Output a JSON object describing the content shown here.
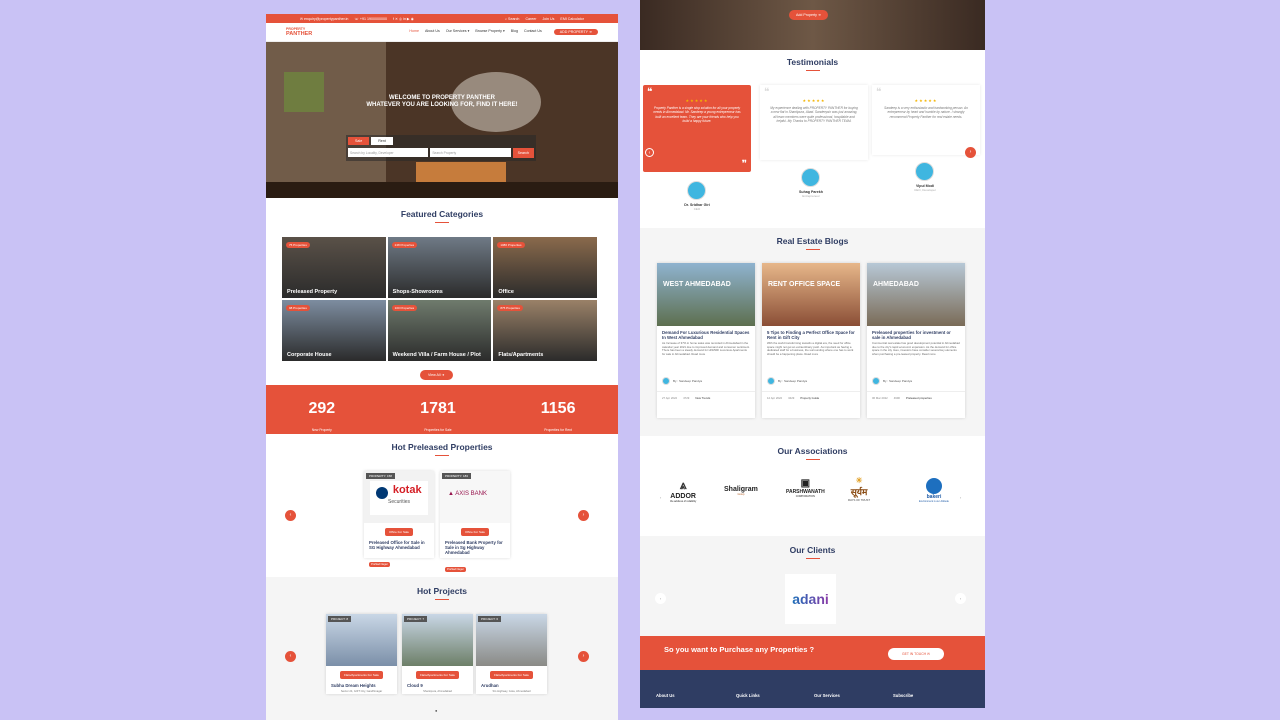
{
  "left": {
    "topbar": {
      "email": "✉ enquiry@propertypanther.in",
      "phone": "☏ +91 1900000000",
      "search": "⌕ Search",
      "links": [
        "Career",
        "Join Us",
        "EMI Calculator"
      ]
    },
    "logo": {
      "line1": "PROPERTY",
      "line2": "PANTHER"
    },
    "nav": [
      "Home",
      "About Us",
      "Our Services ▾",
      "Browse Property ▾",
      "Blog",
      "Contact Us"
    ],
    "nav_cta": "ADD PROPERTY ➜",
    "hero": {
      "line1": "WELCOME TO PROPERTY PANTHER",
      "line2": "WHATEVER YOU ARE LOOKING FOR, FIND IT HERE!"
    },
    "search": {
      "tab_sale": "Sale",
      "tab_rent": "Rent",
      "placeholder_locality": "Search by Locality, Developer",
      "placeholder_property": "Search Property",
      "button": "Search"
    },
    "featured": {
      "title": "Featured Categories",
      "items": [
        {
          "badge": "75 Properties",
          "name": "Preleased Property",
          "color": "#5a5148"
        },
        {
          "badge": "248 Properties",
          "name": "Shops-Showrooms",
          "color": "#6f7a86"
        },
        {
          "badge": "1086 Properties",
          "name": "Office",
          "color": "#8a6a4c"
        },
        {
          "badge": "98 Properties",
          "name": "Corporate House",
          "color": "#7d8da0"
        },
        {
          "badge": "100 Properties",
          "name": "Weekend Villa / Farm House / Plot",
          "color": "#6f7b6d"
        },
        {
          "badge": "875 Properties",
          "name": "Flats/Apartments",
          "color": "#9a8168"
        }
      ],
      "view_all": "View All ➜"
    },
    "stats": [
      {
        "num": "292",
        "label": "New Property"
      },
      {
        "num": "1781",
        "label": "Properties for Sale"
      },
      {
        "num": "1156",
        "label": "Properties for Rent"
      }
    ],
    "preleased": {
      "title": "Hot Preleased Properties",
      "cards": [
        {
          "tag": "PROPERTY: 158",
          "logo": "kotak",
          "logo_sub": "Securities",
          "pill": "Office For Sale",
          "title": "Preleased Office for Sale in SG Highway Ahmedabad",
          "loc": "Prahlad Nagar"
        },
        {
          "tag": "PROPERTY: 183",
          "logo": "AXIS BANK",
          "logo_sub": "",
          "pill": "Office For Sale",
          "title": "Preleased Bank Property for Sale in Sg Highway Ahmedabad",
          "loc": "Prahlad Nagar"
        }
      ]
    },
    "projects": {
      "title": "Hot Projects",
      "cards": [
        {
          "tag": "PROJECT: 8",
          "pill": "Flats/Apartments For Sale",
          "title": "Subha Dream Heights",
          "loc": "Sector 24, GIFT City, Gandhinagar",
          "color": "#7b8fa8"
        },
        {
          "tag": "PROJECT: 7",
          "pill": "Flats/Apartments For Sale",
          "title": "Cloud 9",
          "loc": "Shantipura, Ahmedabad",
          "color": "#6d7f68"
        },
        {
          "tag": "PROJECT: 6",
          "pill": "Flats/Apartments For Sale",
          "title": "Arudhan",
          "loc": "SG Highway, Gota, Ahmedabad",
          "color": "#8a8a86"
        }
      ]
    }
  },
  "right": {
    "add_property": "Add Property ➜",
    "testimonials": {
      "title": "Testimonials",
      "items": [
        {
          "text": "Property Panther is a single stop solution for all your property needs in Ahmedabad. Mr. Sandeep a young entrepreneur has built an excellent team. They are your friends who help you build a happy future.",
          "name": "Dr. Sridhar Giri",
          "role": "CEO"
        },
        {
          "text": "My experience dealing with PROPERTY PANTHER for buying a new flat in Shantipura, Abad. Sandeepsir was just amazing, all team members were quite professional, hospitable and helpful. My Thanks to PROPERTY PANTHER TEAM.",
          "name": "Suhag Parekh",
          "role": "Entrepreneur"
        },
        {
          "text": "Sandeep is a very enthusiastic and hardworking person. An entrepreneur by heart and humble by nature. I strongly recommend Property Panther for real estate needs.",
          "name": "Vipul Modi",
          "role": "CEO, Developer"
        }
      ],
      "stars": "★★★★★"
    },
    "blogs": {
      "title": "Real Estate Blogs",
      "items": [
        {
          "img_text": "WEST AHMEDABAD",
          "title": "Demand For Luxurious Residential Spaces In West Ahmedabad",
          "excerpt": "As Increase of 37% in home sales was recorded in Ahmedabad in the calendar year 2021 due to improved demand and consumer sentiment. There has been a steady demand for HNI/NRI Luxurious Apartments for sale in Ahmedabad. Read more",
          "author": "By : Sandeep Pandya",
          "date": "27 Apr 2022",
          "views": "4729",
          "cat": "New Trends"
        },
        {
          "img_text": "RENT OFFICE SPACE",
          "title": "5 Tips to Finding a Perfect Office Space for Rent in Gift City",
          "excerpt": "With the world transforming towards a digital era, the need for office space might not get an extraordinary push. As important as having a dedicated staff for a business, the surrounding where one has to work should be a happening place. Read more",
          "author": "By : Sandeep Pandya",
          "date": "12 Apr 2022",
          "views": "3429",
          "cat": "Property Guide"
        },
        {
          "img_text": "AHMEDABAD",
          "title": "Preleased properties for investment or sale in Ahmedabad",
          "excerpt": "Commercial real estate has good development potential in Ahmedabad due to the city's rapid economic expansion. As the demand for office space in the city rises, investors have consider several key elements when purchasing a pre-leased property. Read more",
          "author": "By : Sandeep Pandya",
          "date": "06 Mar 2022",
          "views": "4990",
          "cat": "Preleased properties"
        }
      ]
    },
    "associations": {
      "title": "Our Associations",
      "items": [
        {
          "name": "ADDOR",
          "sub": "the address of reliability"
        },
        {
          "name": "Shaligram",
          "sub": "Group"
        },
        {
          "name": "PARSHWANATH",
          "sub": "CORPORATION"
        },
        {
          "name": "सूर्यम",
          "sub": "RAYS OF TRUST"
        },
        {
          "name": "bakeri",
          "sub": "Environment is our Attitude"
        }
      ]
    },
    "clients": {
      "title": "Our Clients",
      "logo": "adani"
    },
    "cta": {
      "text": "So you want to Purchase any Properties ?",
      "button": "GET IN TOUCH ✉"
    },
    "footer": [
      "About Us",
      "Quick Links",
      "Our Services",
      "Subscribe"
    ]
  }
}
